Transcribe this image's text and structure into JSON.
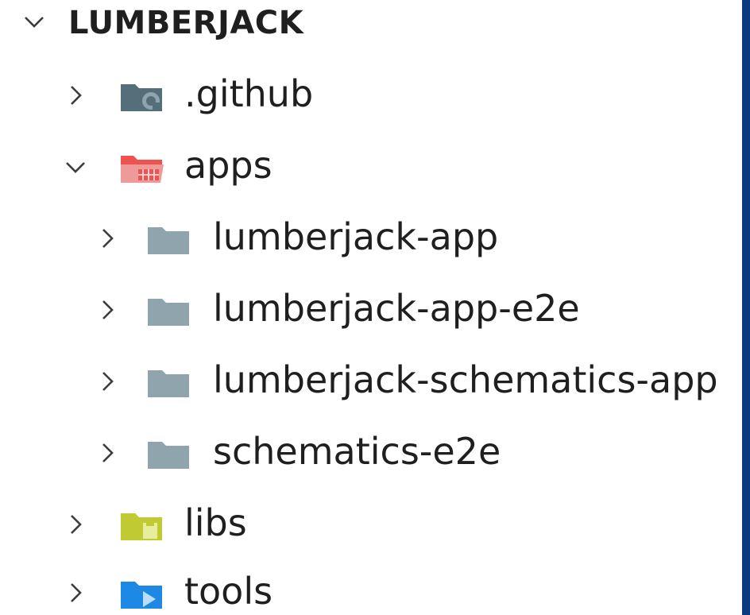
{
  "explorer": {
    "root": {
      "label": "LUMBERJACK",
      "expanded": true,
      "chevron_icon": "chevron-down-icon"
    },
    "items": [
      {
        "label": ".github",
        "expanded": false,
        "icon": "github-folder-icon",
        "icon_color": "#546e7a"
      },
      {
        "label": "apps",
        "expanded": true,
        "icon": "apps-folder-open-icon",
        "icon_color": "#ef5350"
      },
      {
        "label": "lumberjack-app",
        "expanded": false,
        "icon": "folder-icon",
        "icon_color": "#90a4ae"
      },
      {
        "label": "lumberjack-app-e2e",
        "expanded": false,
        "icon": "folder-icon",
        "icon_color": "#90a4ae"
      },
      {
        "label": "lumberjack-schematics-app",
        "expanded": false,
        "icon": "folder-icon",
        "icon_color": "#90a4ae"
      },
      {
        "label": "schematics-e2e",
        "expanded": false,
        "icon": "folder-icon",
        "icon_color": "#90a4ae"
      },
      {
        "label": "libs",
        "expanded": false,
        "icon": "libs-folder-icon",
        "icon_color": "#c0ca33"
      },
      {
        "label": "tools",
        "expanded": false,
        "icon": "tools-folder-icon",
        "icon_color": "#1e88e5"
      }
    ]
  }
}
